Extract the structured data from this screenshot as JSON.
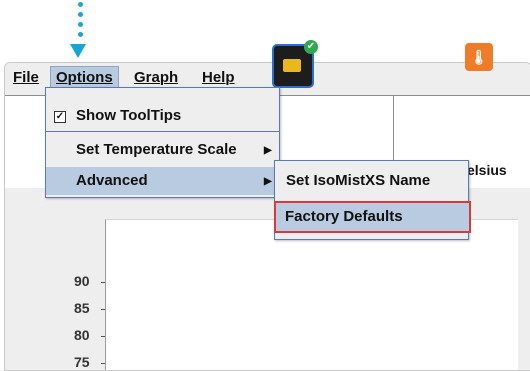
{
  "menubar": {
    "items": [
      {
        "label": "File"
      },
      {
        "label": "Options"
      },
      {
        "label": "Graph"
      },
      {
        "label": "Help"
      }
    ]
  },
  "options_menu": {
    "show_tooltips": "Show ToolTips",
    "set_temperature_scale": "Set Temperature Scale",
    "advanced": "Advanced"
  },
  "advanced_menu": {
    "set_name": "Set IsoMistXS Name",
    "factory_defaults": "Factory Defaults"
  },
  "toolbar": {
    "celsius_label": "elsius"
  },
  "graph": {
    "y_ticks": [
      "90",
      "85",
      "80",
      "75"
    ]
  },
  "colors": {
    "annotation": "#16a6d6",
    "highlight": "#b9cbe0",
    "callout_border": "#d73a3a"
  }
}
